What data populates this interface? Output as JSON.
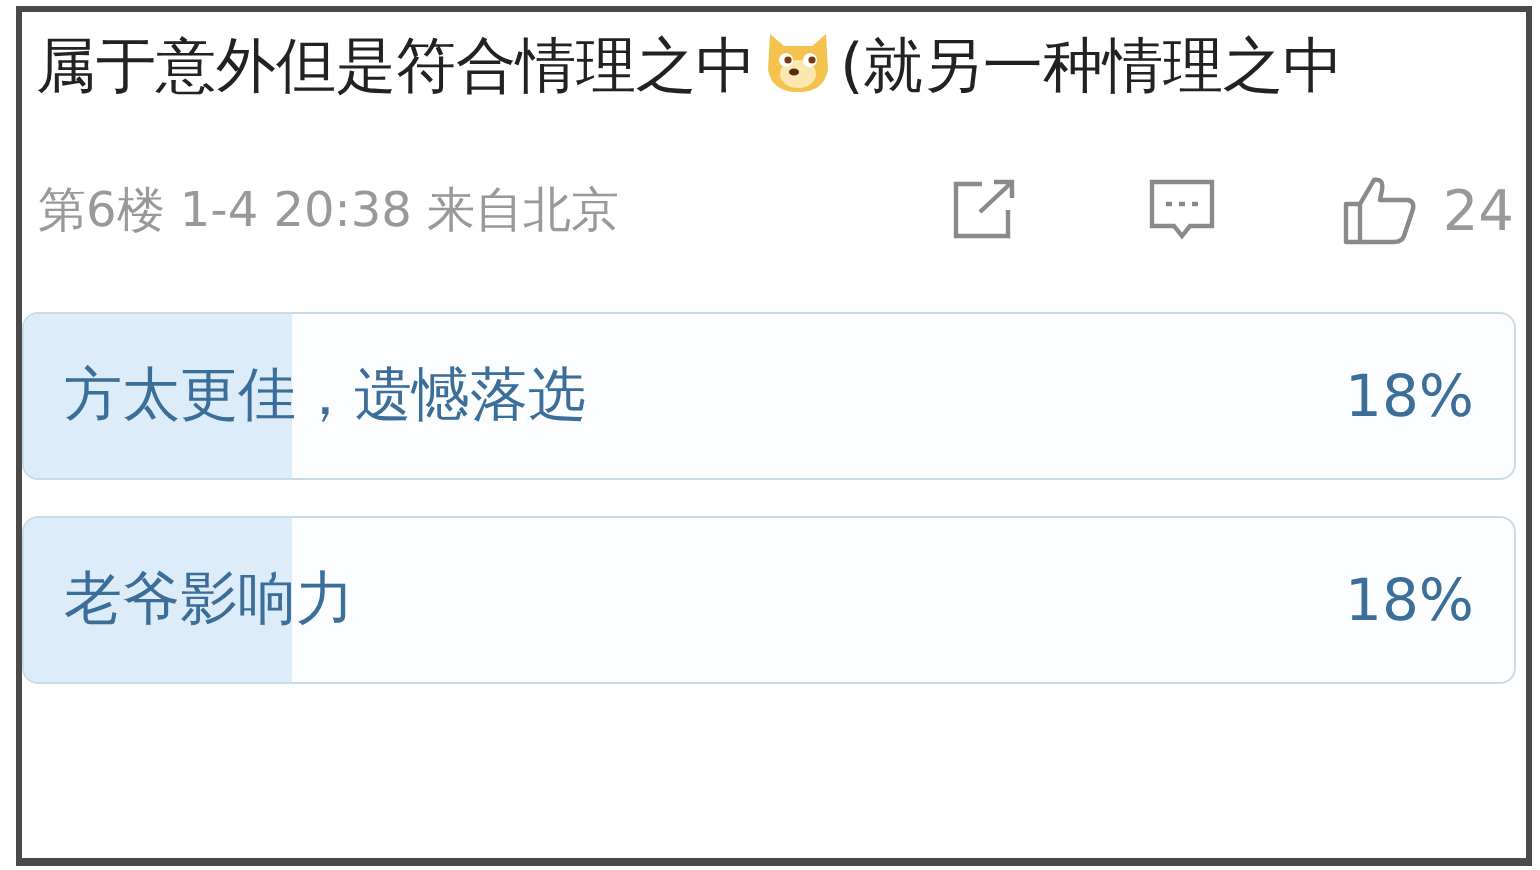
{
  "post": {
    "text_before_emoji": "属于意外但是符合情理之中",
    "text_after_emoji": "(就另一种情理之中",
    "meta": "第6楼 1-4 20:38 来自北京",
    "like_count": "24"
  },
  "poll": {
    "options": [
      {
        "label": "方太更佳，遗憾落选",
        "percent": "18%",
        "level": 0.18
      },
      {
        "label": "老爷影响力",
        "percent": "18%",
        "level": 0.18
      }
    ]
  }
}
